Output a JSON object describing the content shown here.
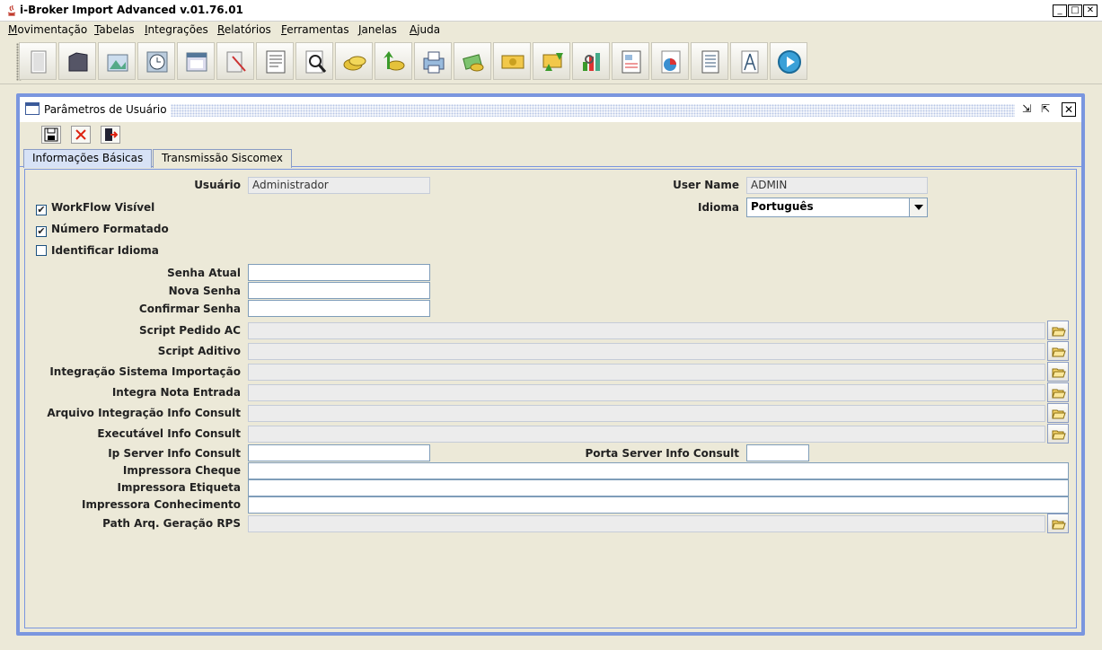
{
  "window": {
    "title": "i-Broker Import Advanced v.01.76.01"
  },
  "menu": [
    "Movimentação",
    "Tabelas",
    "Integrações",
    "Relatórios",
    "Ferramentas",
    "Janelas",
    "Ajuda"
  ],
  "toolbar": {
    "icons": [
      "document-icon",
      "folder-icon",
      "image-icon",
      "clock-icon",
      "window-icon",
      "cut-icon",
      "report-icon",
      "search-icon",
      "coins-icon",
      "recycle-coins-icon",
      "printer-icon",
      "money-icon",
      "cash-icon",
      "currency-exchange-icon",
      "chart-icon",
      "form-icon",
      "pie-chart-icon",
      "list-icon",
      "compass-icon",
      "play-icon"
    ]
  },
  "frame": {
    "title": "Parâmetros de Usuário",
    "tabs": [
      "Informações Básicas",
      "Transmissão Siscomex"
    ]
  },
  "form": {
    "usuario_label": "Usuário",
    "usuario_value": "Administrador",
    "username_label": "User Name",
    "username_value": "ADMIN",
    "idioma_label": "Idioma",
    "idioma_value": "Português",
    "workflow_label": "WorkFlow Visível",
    "workflow_checked": true,
    "numero_label": "Número Formatado",
    "numero_checked": true,
    "identificar_label": "Identificar Idioma",
    "identificar_checked": false,
    "senha_atual_label": "Senha Atual",
    "nova_senha_label": "Nova Senha",
    "confirmar_senha_label": "Confirmar Senha",
    "script_pedido_label": "Script Pedido AC",
    "script_aditivo_label": "Script Aditivo",
    "integracao_label": "Integração Sistema Importação",
    "integra_nota_label": "Integra Nota Entrada",
    "arquivo_label": "Arquivo Integração Info Consult",
    "executavel_label": "Executável Info Consult",
    "ip_server_label": "Ip Server Info Consult",
    "porta_server_label": "Porta Server Info Consult",
    "impressora_cheque_label": "Impressora Cheque",
    "impressora_etiqueta_label": "Impressora Etiqueta",
    "impressora_conhecimento_label": "Impressora Conhecimento",
    "path_rps_label": "Path Arq. Geração RPS"
  }
}
